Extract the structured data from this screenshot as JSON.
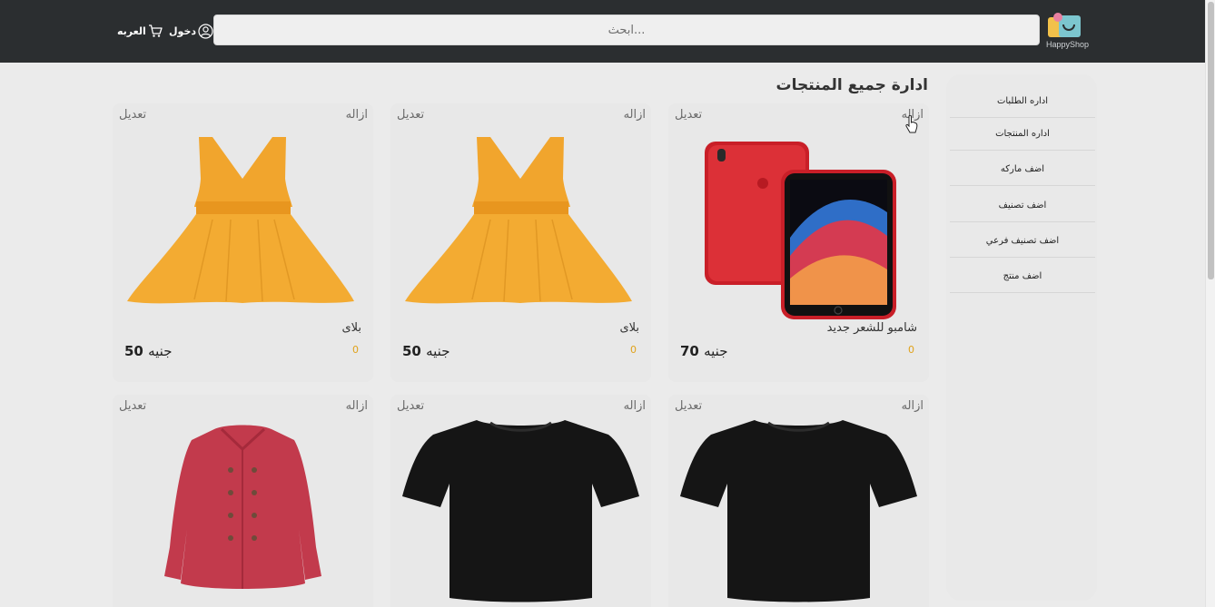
{
  "header": {
    "logo_text": "HappyShop",
    "search_placeholder": "ابحث...",
    "login_label": "دخول",
    "cart_label": "العربه"
  },
  "sidebar": {
    "items": [
      {
        "label": "اداره الطلبات"
      },
      {
        "label": "اداره المنتجات"
      },
      {
        "label": "اضف ماركه"
      },
      {
        "label": "اضف تصنيف"
      },
      {
        "label": "اضف تصنيف فرعي"
      },
      {
        "label": "اضف منتج"
      }
    ]
  },
  "main": {
    "title": "ادارة جميع المنتجات",
    "products": [
      {
        "remove": "ازاله",
        "edit": "تعديل",
        "name": "شامبو للشعر جديد",
        "rating": "0",
        "price": "70",
        "currency": "جنيه",
        "icon": "red-phone-image"
      },
      {
        "remove": "ازاله",
        "edit": "تعديل",
        "name": "بلاى",
        "rating": "0",
        "price": "50",
        "currency": "جنيه",
        "icon": "yellow-dress-image"
      },
      {
        "remove": "ازاله",
        "edit": "تعديل",
        "name": "بلاى",
        "rating": "0",
        "price": "50",
        "currency": "جنيه",
        "icon": "yellow-dress-image"
      },
      {
        "remove": "ازاله",
        "edit": "تعديل",
        "icon": "black-tshirt-image"
      },
      {
        "remove": "ازاله",
        "edit": "تعديل",
        "icon": "black-tshirt-image"
      },
      {
        "remove": "ازاله",
        "edit": "تعديل",
        "icon": "red-coat-image"
      }
    ]
  },
  "colors": {
    "header_bg": "#2b2e30",
    "page_bg": "#ebebeb",
    "rating": "#e0a21a",
    "dress": "#f0a62e",
    "phone": "#d6282f",
    "coat": "#c63b4e"
  }
}
